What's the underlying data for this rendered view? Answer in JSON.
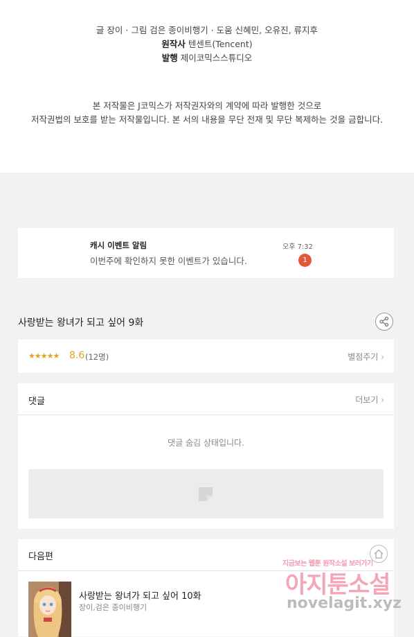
{
  "credits": {
    "line1": "글 장이 · 그림 검은 종이비행기 · 도움 신혜민, 오유진, 류지후",
    "original_label": "원작사",
    "original_value": "텐센트(Tencent)",
    "publisher_label": "발행",
    "publisher_value": "제이코믹스스튜디오",
    "copyright_line1": "본 저작물은 J코믹스가 저작권자와의 계약에 따라 발행한 것으로",
    "copyright_line2": "저작권법의 보호를 받는 저작물입니다. 본 서의 내용을 무단 전재 및 무단 복제하는 것을 금합니다."
  },
  "notification": {
    "title": "캐시 이벤트 알림",
    "message": "이번주에 확인하지 못한 이벤트가 있습니다.",
    "time": "오후 7:32",
    "badge": "1"
  },
  "episode": {
    "title": "사랑받는 왕녀가 되고 싶어 9화",
    "share_icon": "share-icon"
  },
  "rating": {
    "stars": "★★★★★",
    "score": "8.6",
    "count": "(12명)",
    "rate_link": "별점주기",
    "star_fraction": 0.86,
    "accent_color": "#e8a020"
  },
  "comments": {
    "header": "댓글",
    "more": "더보기",
    "empty_message": "댓글 숨김 상태입니다."
  },
  "next_episode": {
    "header": "다음편",
    "title": "사랑받는 왕녀가 되고 싶어 10화",
    "author": "장이,검은 종이비행기"
  },
  "watermark": {
    "small": "지금보는 웹툰 원작소설 보러가기",
    "big": "아지툰소설",
    "url": "novelagit.xyz"
  }
}
